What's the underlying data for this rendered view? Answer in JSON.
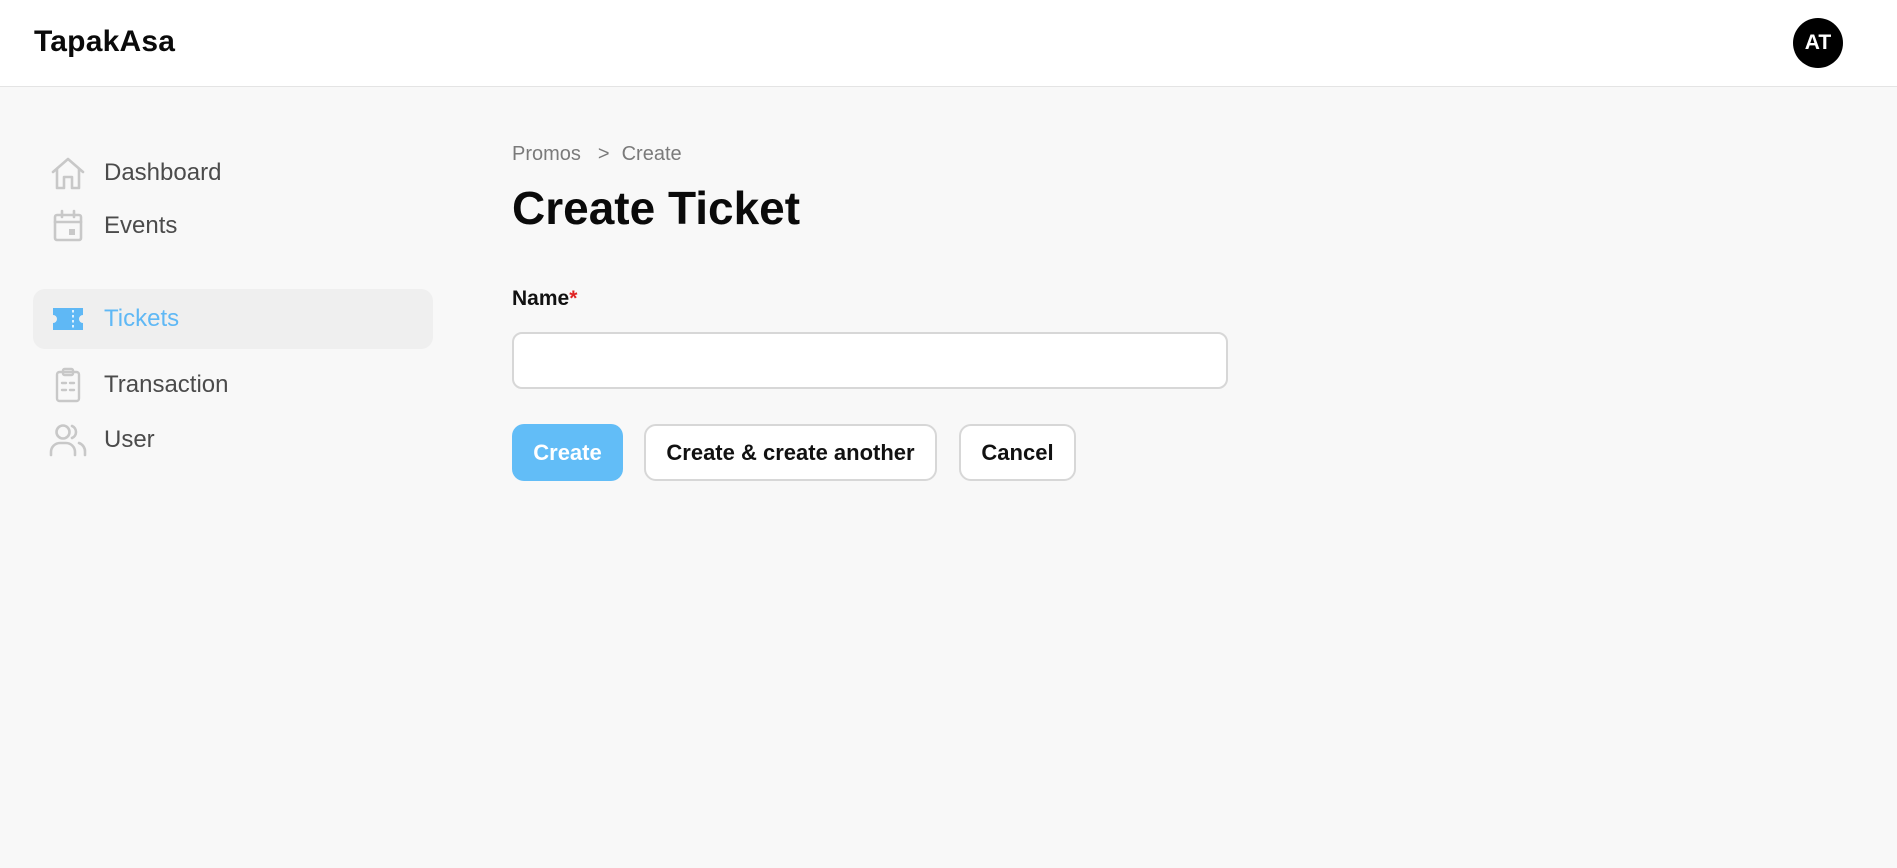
{
  "app": {
    "brand": "TapakAsa",
    "user_initials": "AT"
  },
  "sidebar": {
    "items": [
      {
        "label": "Dashboard",
        "icon": "home-icon"
      },
      {
        "label": "Events",
        "icon": "calendar-icon"
      },
      {
        "label": "Tickets",
        "icon": "ticket-icon",
        "active": true
      },
      {
        "label": "Transaction",
        "icon": "clipboard-icon"
      },
      {
        "label": "User",
        "icon": "users-icon"
      }
    ]
  },
  "breadcrumb": {
    "parent": "Promos",
    "separator": ">",
    "current": "Create"
  },
  "page": {
    "title": "Create Ticket"
  },
  "form": {
    "name_label": "Name",
    "required_mark": "*",
    "name_value": ""
  },
  "actions": {
    "create": "Create",
    "create_another": "Create & create another",
    "cancel": "Cancel"
  },
  "colors": {
    "accent": "#62bdf7",
    "active_nav_bg": "#efefef",
    "required": "#e02424",
    "icon_gray": "#c8c8c8"
  }
}
